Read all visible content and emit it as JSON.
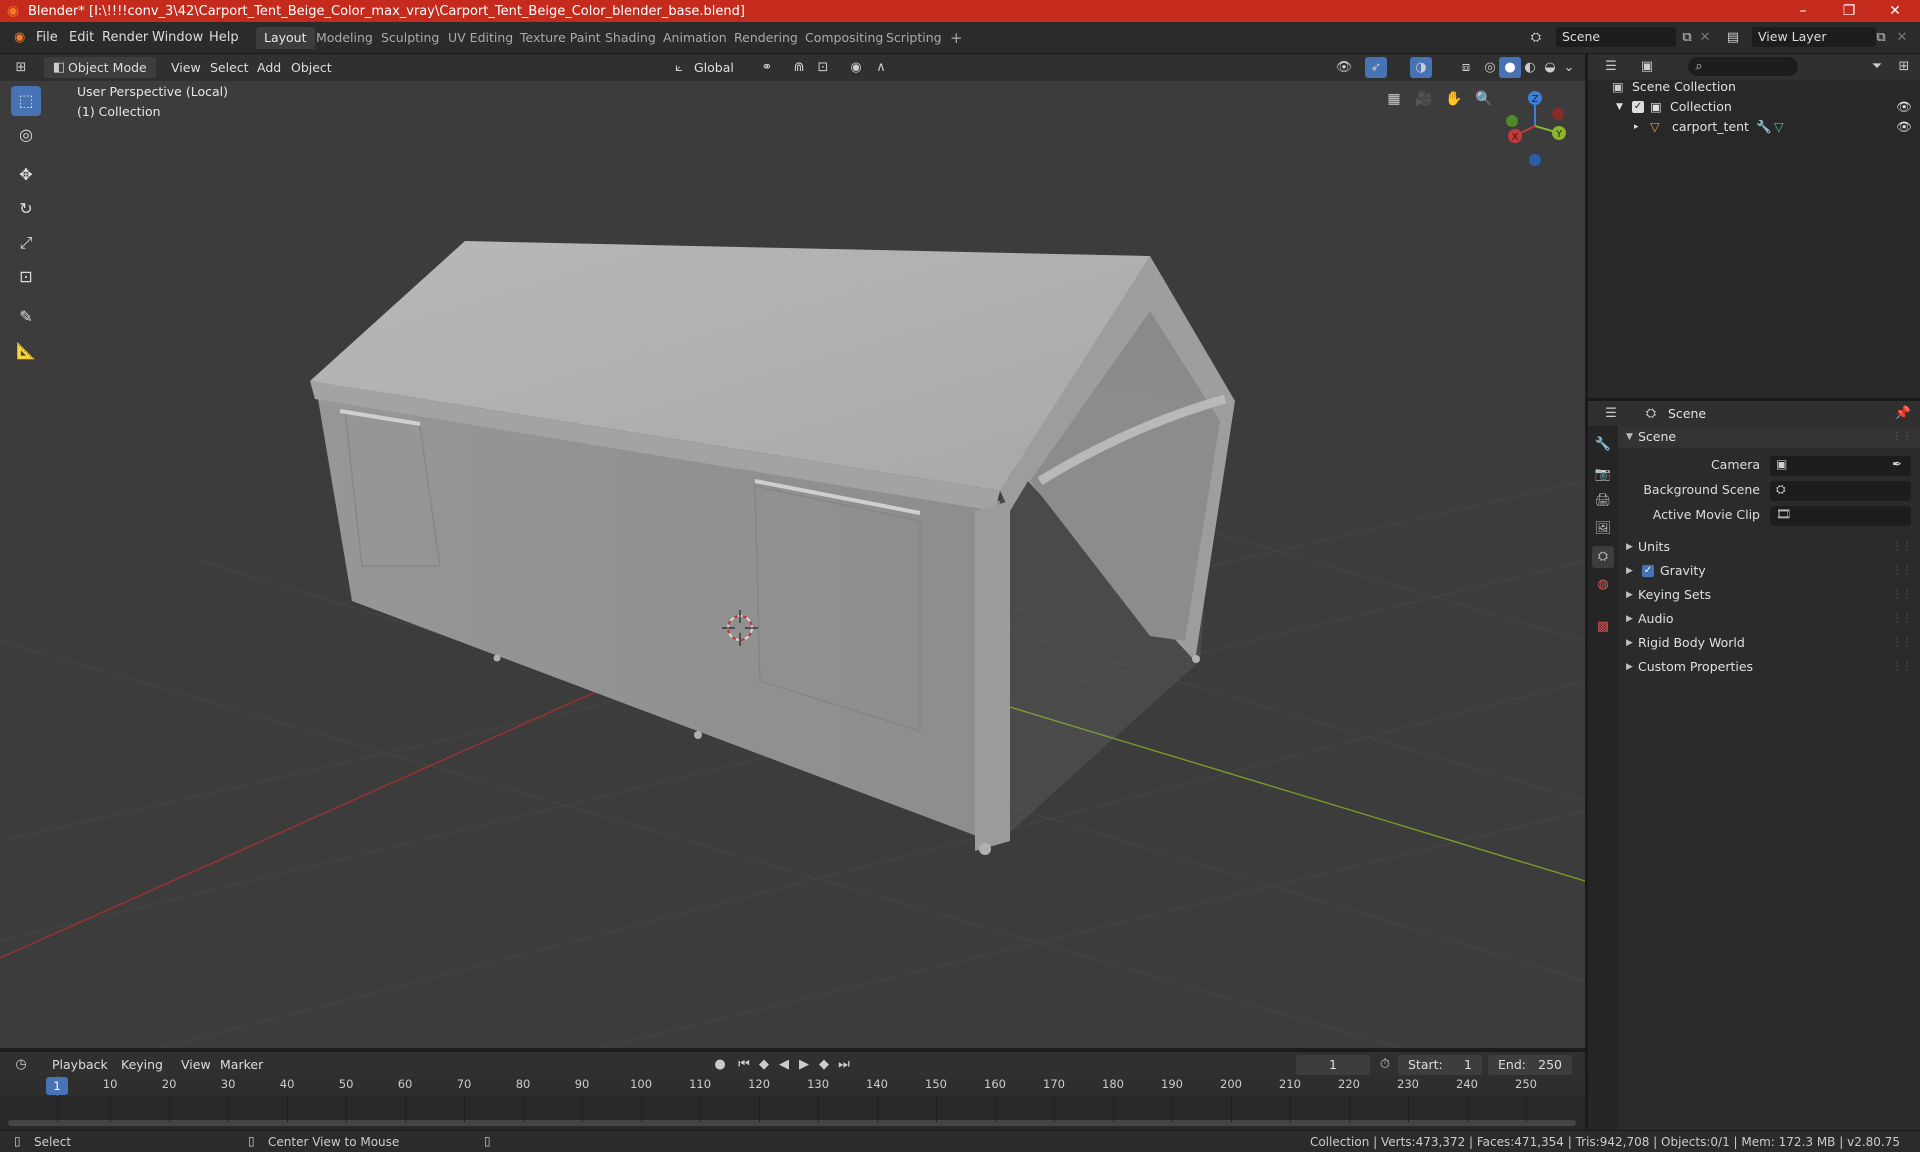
{
  "window": {
    "title": "Blender* [I:\\!!!!conv_3\\42\\Carport_Tent_Beige_Color_max_vray\\Carport_Tent_Beige_Color_blender_base.blend]",
    "minimize_icon": "minimize-icon",
    "maximize_icon": "maximize-icon",
    "close_icon": "close-icon"
  },
  "menu": [
    "File",
    "Edit",
    "Render",
    "Window",
    "Help"
  ],
  "workspaces": [
    {
      "label": "Layout",
      "active": true
    },
    {
      "label": "Modeling"
    },
    {
      "label": "Sculpting"
    },
    {
      "label": "UV Editing"
    },
    {
      "label": "Texture Paint"
    },
    {
      "label": "Shading"
    },
    {
      "label": "Animation"
    },
    {
      "label": "Rendering"
    },
    {
      "label": "Compositing"
    },
    {
      "label": "Scripting"
    }
  ],
  "add_workspace": "+",
  "scene_selector": {
    "value": "Scene"
  },
  "view_layer_selector": {
    "value": "View Layer"
  },
  "viewport_header": {
    "mode": "Object Mode",
    "menus": [
      "View",
      "Select",
      "Add",
      "Object"
    ],
    "orientation": "Global"
  },
  "viewport": {
    "perspective_label": "User Perspective (Local)",
    "collection_label": "(1) Collection",
    "gizmo": {
      "x": "X",
      "y": "Y",
      "z": "Z"
    }
  },
  "outliner": {
    "search_placeholder": "",
    "root": "Scene Collection",
    "collection": "Collection",
    "object": "carport_tent"
  },
  "properties": {
    "header_title": "Scene",
    "section": "Scene",
    "camera_label": "Camera",
    "background_scene_label": "Background Scene",
    "active_movie_clip_label": "Active Movie Clip",
    "panels": [
      "Units",
      "Gravity",
      "Keying Sets",
      "Audio",
      "Rigid Body World",
      "Custom Properties"
    ]
  },
  "timeline": {
    "menus": [
      "Playback",
      "Keying",
      "View",
      "Marker"
    ],
    "current_frame": "1",
    "start_label": "Start:",
    "start_value": "1",
    "end_label": "End:",
    "end_value": "250",
    "ticks": [
      "1",
      "10",
      "20",
      "30",
      "40",
      "50",
      "60",
      "70",
      "80",
      "90",
      "100",
      "110",
      "120",
      "130",
      "140",
      "150",
      "160",
      "170",
      "180",
      "190",
      "200",
      "210",
      "220",
      "230",
      "240",
      "250"
    ]
  },
  "status": {
    "select": "Select",
    "center_view": "Center View to Mouse",
    "stats": "Collection | Verts:473,372 | Faces:471,354 | Tris:942,708 | Objects:0/1 | Mem: 172.3 MB | v2.80.75"
  },
  "colors": {
    "title_bar": "#c42b1c",
    "accent": "#4772b3",
    "x_axis": "#c23a3a",
    "y_axis": "#8ab52c",
    "z_axis": "#3f7fd6"
  }
}
